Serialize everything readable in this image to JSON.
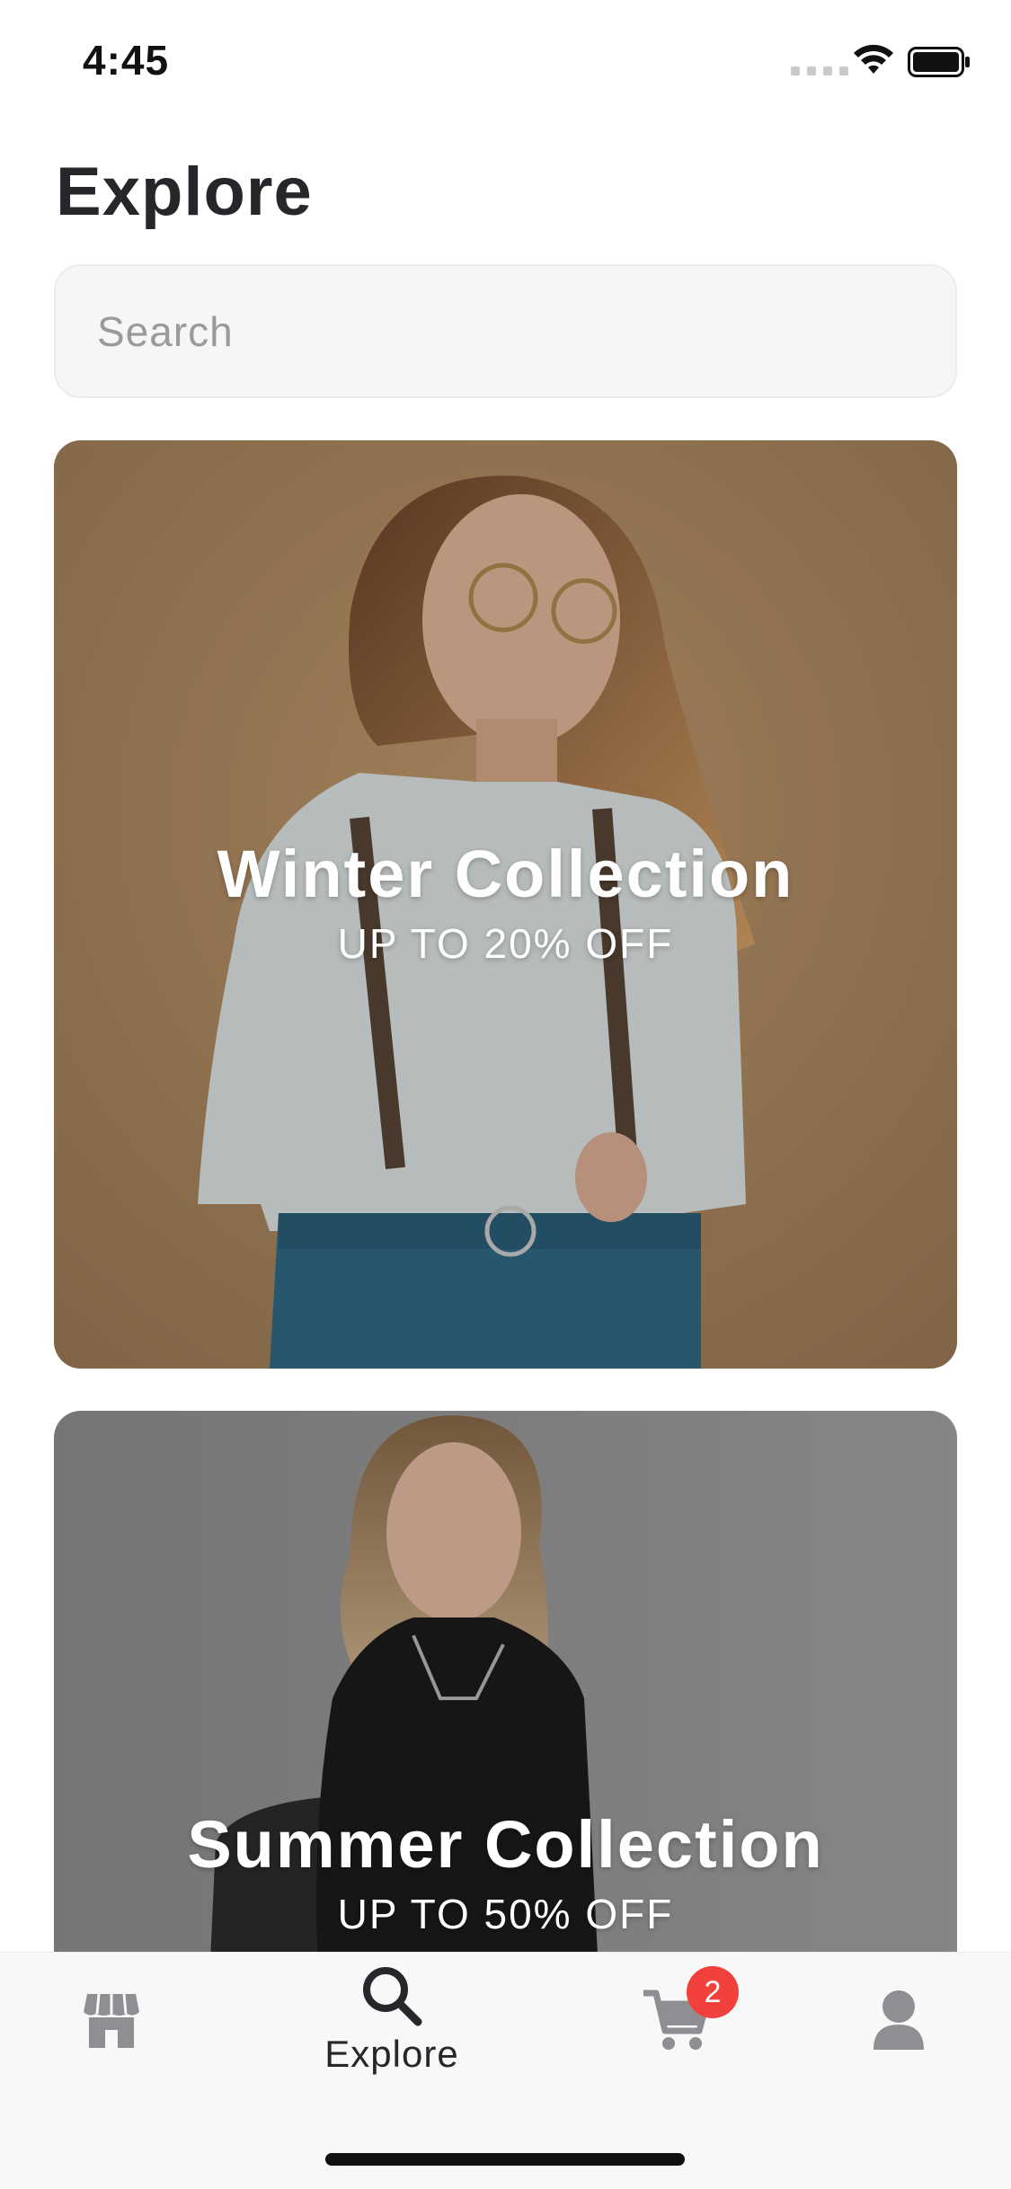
{
  "status_bar": {
    "time": "4:45"
  },
  "header": {
    "title": "Explore"
  },
  "search": {
    "placeholder": "Search",
    "value": ""
  },
  "collections": [
    {
      "title": "Winter Collection",
      "subtitle": "UP TO 20% OFF"
    },
    {
      "title": "Summer Collection",
      "subtitle": "UP TO 50% OFF"
    }
  ],
  "tab_bar": {
    "items": [
      {
        "icon": "store-icon",
        "label": ""
      },
      {
        "icon": "search-icon",
        "label": "Explore",
        "active": true
      },
      {
        "icon": "cart-icon",
        "label": "",
        "badge": "2"
      },
      {
        "icon": "user-icon",
        "label": ""
      }
    ]
  },
  "colors": {
    "badge": "#f2413c",
    "text_primary": "#26262b",
    "icon_inactive": "#8e8e93",
    "tab_bar_bg": "#f8f8f8"
  }
}
